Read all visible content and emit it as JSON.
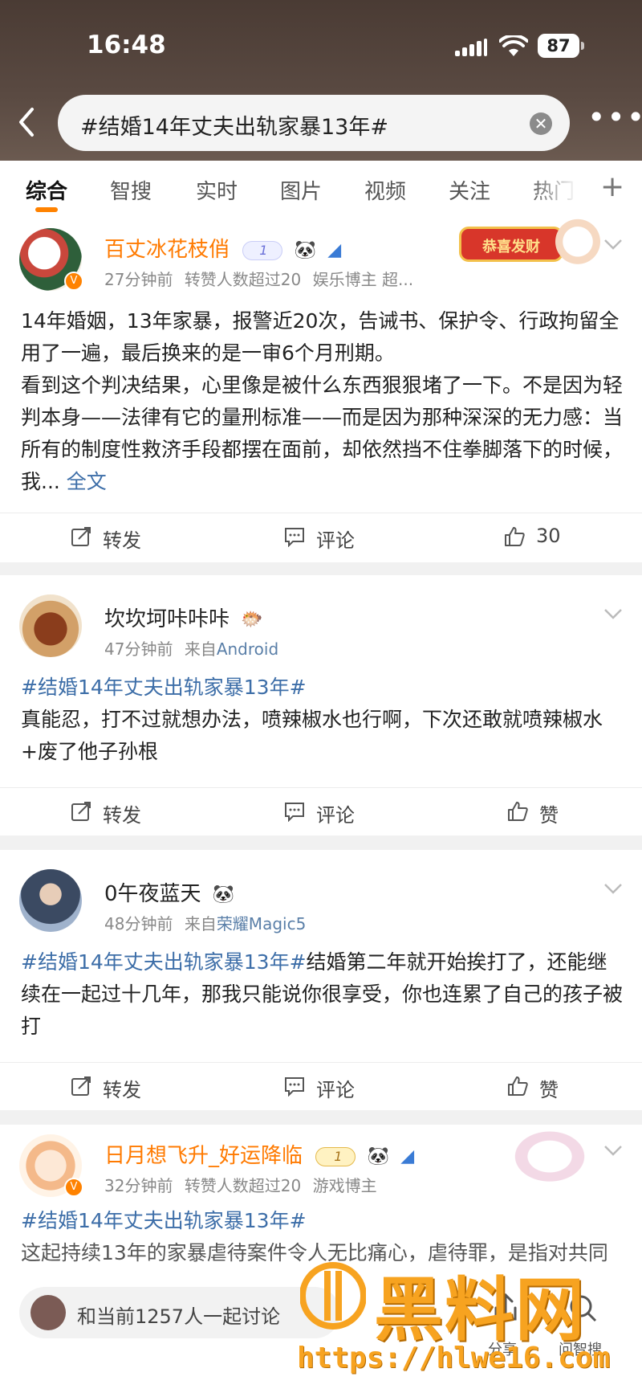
{
  "status": {
    "time": "16:48",
    "battery": "87"
  },
  "search": {
    "query": "#结婚14年丈夫出轨家暴13年#"
  },
  "tabs": [
    "综合",
    "智搜",
    "实时",
    "图片",
    "视频",
    "关注",
    "热门"
  ],
  "posts": [
    {
      "username": "百丈冰花枝俏",
      "meta_time": "27分钟前",
      "meta_extra": "转赞人数超过20",
      "meta_role": "娱乐博主 超...",
      "level": "1",
      "text": "14年婚姻，13年家暴，报警近20次，告诫书、保护令、行政拘留全用了一遍，最后换来的是一审6个月刑期。\n看到这个判决结果，心里像是被什么东西狠狠堵了一下。不是因为轻判本身——法律有它的量刑标准——而是因为那种深深的无力感：当所有的制度性救济手段都摆在面前，却依然挡不住拳脚落下的时候，我...",
      "more": "全文",
      "deco_text": "恭喜发财",
      "repost": "转发",
      "comment": "评论",
      "like": "30"
    },
    {
      "username": "坎坎坷咔咔咔",
      "meta_time": "47分钟前",
      "meta_source_prefix": "来自",
      "meta_source": "Android",
      "tag": "#结婚14年丈夫出轨家暴13年#",
      "text": "真能忍，打不过就想办法，喷辣椒水也行啊，下次还敢就喷辣椒水+废了他子孙根",
      "repost": "转发",
      "comment": "评论",
      "like": "赞"
    },
    {
      "username": "0午夜蓝天",
      "meta_time": "48分钟前",
      "meta_source_prefix": "来自",
      "meta_source": "荣耀Magic5",
      "tag": "#结婚14年丈夫出轨家暴13年#",
      "text": "结婚第二年就开始挨打了，还能继续在一起过十几年，那我只能说你很享受，你也连累了自己的孩子被打",
      "repost": "转发",
      "comment": "评论",
      "like": "赞"
    },
    {
      "username": "日月想飞升_好运降临",
      "meta_time": "32分钟前",
      "meta_extra": "转赞人数超过20",
      "meta_role": "游戏博主",
      "level": "1",
      "tag": "#结婚14年丈夫出轨家暴13年#",
      "text": "这起持续13年的家暴虐待案件令人无比痛心，虐待罪，是指对共同"
    }
  ],
  "bottom": {
    "discuss": "和当前1257人一起讨论",
    "share": "分享",
    "ask": "问智搜"
  },
  "watermark": {
    "brand": "黑料网",
    "url": "https://hlwe16.com"
  },
  "colors": {
    "accent": "#ff8200",
    "link": "#3d6ea8",
    "username_orange": "#ff7a00"
  }
}
